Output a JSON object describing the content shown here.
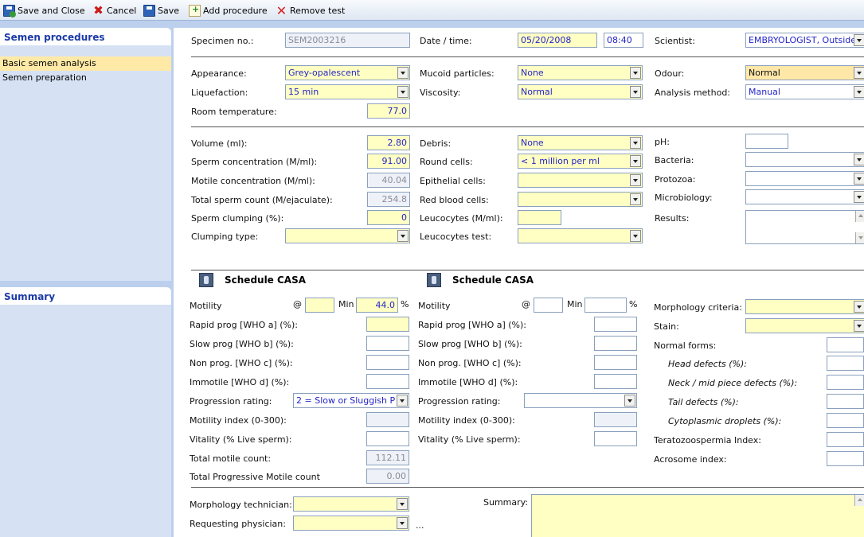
{
  "toolbar": {
    "save_close": "Save and Close",
    "cancel": "Cancel",
    "save": "Save",
    "add_procedure": "Add procedure",
    "remove_test": "Remove test"
  },
  "sidebar": {
    "procedures_title": "Semen procedures",
    "items": [
      {
        "label": "Basic semen analysis",
        "selected": true
      },
      {
        "label": "Semen preparation",
        "selected": false
      }
    ],
    "summary_title": "Summary"
  },
  "header": {
    "specimen_label": "Specimen no.:",
    "specimen_value": "SEM2003216",
    "date_label": "Date / time:",
    "date_value": "05/20/2008",
    "time_value": "08:40",
    "scientist_label": "Scientist:",
    "scientist_value": "EMBRYOLOGIST, Outside"
  },
  "appearance": {
    "appearance_label": "Appearance:",
    "appearance_value": "Grey-opalescent",
    "liquefaction_label": "Liquefaction:",
    "liquefaction_value": "15 min",
    "room_temp_label": "Room temperature:",
    "room_temp_value": "77.0",
    "mucoid_label": "Mucoid particles:",
    "mucoid_value": "None",
    "viscosity_label": "Viscosity:",
    "viscosity_value": "Normal",
    "odour_label": "Odour:",
    "odour_value": "Normal",
    "method_label": "Analysis method:",
    "method_value": "Manual"
  },
  "counts": {
    "volume_label": "Volume (ml):",
    "volume_value": "2.80",
    "sperm_conc_label": "Sperm concentration (M/ml):",
    "sperm_conc_value": "91.00",
    "motile_conc_label": "Motile concentration (M/ml):",
    "motile_conc_value": "40.04",
    "total_count_label": "Total sperm count (M/ejaculate):",
    "total_count_value": "254.8",
    "clumping_label": "Sperm clumping (%):",
    "clumping_value": "0",
    "clumping_type_label": "Clumping type:",
    "clumping_type_value": "",
    "debris_label": "Debris:",
    "debris_value": "None",
    "round_cells_label": "Round cells:",
    "round_cells_value": "< 1 million per ml",
    "epithelial_label": "Epithelial cells:",
    "epithelial_value": "",
    "rbc_label": "Red blood cells:",
    "rbc_value": "",
    "leucocytes_label": "Leucocytes (M/ml):",
    "leucocytes_value": "",
    "leuco_test_label": "Leucocytes test:",
    "leuco_test_value": "",
    "ph_label": "pH:",
    "ph_value": "",
    "bacteria_label": "Bacteria:",
    "bacteria_value": "",
    "protozoa_label": "Protozoa:",
    "protozoa_value": "",
    "micro_label": "Microbiology:",
    "micro_value": "",
    "results_label": "Results:",
    "results_value": ""
  },
  "casa1": {
    "title": "Schedule CASA",
    "motility_label": "Motility",
    "at_label": "@",
    "at_value": "",
    "min_label": "Min",
    "motility_value": "44.0",
    "pct_label": "%",
    "rapid_label": "Rapid prog [WHO a] (%):",
    "rapid_value": "",
    "slow_label": "Slow prog [WHO b] (%):",
    "slow_value": "",
    "nonprog_label": "Non prog. [WHO c] (%):",
    "nonprog_value": "",
    "immotile_label": "Immotile [WHO d] (%):",
    "immotile_value": "",
    "progression_label": "Progression rating:",
    "progression_value": "2 = Slow or Sluggish P",
    "mot_index_label": "Motility index (0-300):",
    "mot_index_value": "",
    "vitality_label": "Vitality (% Live sperm):",
    "vitality_value": "",
    "tmc_label": "Total motile count:",
    "tmc_value": "112.11",
    "tpmc_label": "Total Progressive Motile count",
    "tpmc_value": "0.00"
  },
  "casa2": {
    "title": "Schedule CASA",
    "motility_label": "Motility",
    "at_label": "@",
    "at_value": "",
    "min_label": "Min",
    "motility_value": "",
    "pct_label": "%",
    "rapid_label": "Rapid prog [WHO a] (%):",
    "rapid_value": "",
    "slow_label": "Slow prog [WHO b] (%):",
    "slow_value": "",
    "nonprog_label": "Non prog. [WHO c] (%):",
    "nonprog_value": "",
    "immotile_label": "Immotile [WHO d] (%):",
    "immotile_value": "",
    "progression_label": "Progression rating:",
    "progression_value": "",
    "mot_index_label": "Motility index (0-300):",
    "mot_index_value": "",
    "vitality_label": "Vitality (% Live sperm):",
    "vitality_value": ""
  },
  "morphology": {
    "criteria_label": "Morphology criteria:",
    "criteria_value": "",
    "stain_label": "Stain:",
    "stain_value": "",
    "normal_label": "Normal forms:",
    "normal_value": "",
    "head_label": "Head defects (%):",
    "head_value": "",
    "neck_label": "Neck / mid piece defects (%):",
    "neck_value": "",
    "tail_label": "Tail defects (%):",
    "tail_value": "",
    "cyto_label": "Cytoplasmic droplets (%):",
    "cyto_value": "",
    "terato_label": "Teratozoospermia Index:",
    "terato_value": "",
    "acrosome_label": "Acrosome index:",
    "acrosome_value": ""
  },
  "footer": {
    "tech_label": "Morphology technician:",
    "tech_value": "",
    "physician_label": "Requesting physician:",
    "physician_value": "",
    "physician_more": "...",
    "summary_label": "Summary:",
    "summary_value": ""
  }
}
